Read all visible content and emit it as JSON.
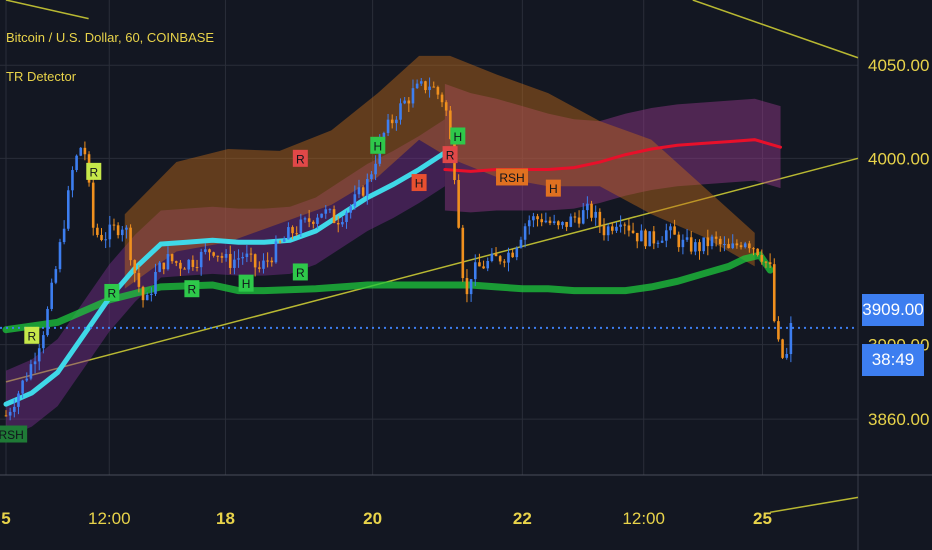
{
  "header": {
    "title": "Bitcoin / U.S. Dollar, 60, COINBASE",
    "indicator": "TR Detector"
  },
  "price_axis": {
    "current_price": "3909.00",
    "countdown": "38:49"
  },
  "colors": {
    "background": "#131722",
    "header_text": "#e8d34a",
    "axis_text": "#e8d34a",
    "price_tag": "#3d7ef0",
    "candle_up": "#3d7ef0",
    "candle_down": "#f0901e",
    "ma_cyan": "#3fd8e8",
    "ma_green": "#1ec83c",
    "ma_red": "#e8102a",
    "trendline": "#b8b832"
  },
  "chart_data": {
    "type": "line",
    "title": "Bitcoin / U.S. Dollar, 60, COINBASE",
    "ylim": [
      3830,
      4085
    ],
    "y_ticks": [
      {
        "label": "4050.00",
        "value": 4050
      },
      {
        "label": "4000.00",
        "value": 4000
      },
      {
        "label": "3900.00",
        "value": 3900
      },
      {
        "label": "3860.00",
        "value": 3860
      }
    ],
    "x_ticks": [
      {
        "label": "5",
        "t": 0
      },
      {
        "label": "12:00",
        "t": 2
      },
      {
        "label": "18",
        "t": 4.25
      },
      {
        "label": "20",
        "t": 7.1
      },
      {
        "label": "22",
        "t": 10.0
      },
      {
        "label": "12:00",
        "t": 12.35
      },
      {
        "label": "25",
        "t": 14.65
      }
    ],
    "x_range": [
      0,
      16.5
    ],
    "series": [
      {
        "key": "price",
        "x": [
          0,
          0.25,
          0.5,
          0.75,
          1.0,
          1.3,
          1.5,
          1.7,
          1.9,
          2.1,
          2.3,
          2.5,
          2.7,
          2.9,
          3.1,
          3.4,
          3.7,
          4.0,
          4.3,
          4.6,
          4.9,
          5.2,
          5.5,
          5.8,
          6.1,
          6.4,
          6.7,
          7.0,
          7.3,
          7.6,
          7.9,
          8.2,
          8.5,
          8.7,
          8.9,
          9.0,
          9.2,
          9.5,
          9.8,
          10.1,
          10.4,
          10.7,
          11.0,
          11.3,
          11.6,
          11.9,
          12.2,
          12.5,
          12.8,
          13.1,
          13.4,
          13.7,
          14.0,
          14.3,
          14.6,
          14.8,
          14.9,
          15.0,
          15.1,
          15.2
        ],
        "values": [
          3862,
          3875,
          3890,
          3910,
          3945,
          3995,
          4010,
          3960,
          3958,
          3962,
          3965,
          3938,
          3920,
          3938,
          3946,
          3943,
          3946,
          3952,
          3944,
          3948,
          3940,
          3950,
          3960,
          3965,
          3972,
          3967,
          3975,
          3987,
          4012,
          4026,
          4036,
          4040,
          4030,
          3990,
          3921,
          3938,
          3942,
          3946,
          3950,
          3967,
          3968,
          3962,
          3968,
          3972,
          3961,
          3969,
          3959,
          3956,
          3961,
          3954,
          3952,
          3956,
          3950,
          3957,
          3950,
          3940,
          3905,
          3895,
          3890,
          3909
        ]
      },
      {
        "key": "ma_cyan",
        "x": [
          0,
          0.5,
          1.0,
          1.5,
          2.0,
          2.5,
          3.0,
          3.5,
          4.0,
          4.5,
          5.0,
          5.5,
          6.0,
          6.5,
          7.0,
          7.5,
          8.0,
          8.5
        ],
        "values": [
          3868,
          3874,
          3885,
          3905,
          3925,
          3941,
          3954,
          3955,
          3956,
          3955,
          3955,
          3956,
          3961,
          3970,
          3979,
          3986,
          3994,
          4003
        ]
      },
      {
        "key": "ma_green",
        "x": [
          0,
          1,
          2,
          3,
          4,
          4.5,
          5,
          6,
          7,
          7.5,
          8,
          8.5,
          9,
          9.5,
          10,
          10.5,
          11,
          11.5,
          12,
          12.5,
          13,
          13.5,
          14,
          14.3,
          14.6,
          14.8
        ],
        "values": [
          3908,
          3912,
          3924,
          3931,
          3932,
          3929,
          3929,
          3930,
          3932,
          3932,
          3932,
          3932,
          3932,
          3931,
          3930,
          3930,
          3929,
          3929,
          3929,
          3931,
          3934,
          3938,
          3942,
          3946,
          3948,
          3940
        ]
      },
      {
        "key": "ma_red",
        "x": [
          8.5,
          9.0,
          9.5,
          10,
          10.5,
          11,
          11.5,
          12,
          12.5,
          13,
          13.5,
          14,
          14.5,
          15
        ],
        "values": [
          3994,
          3993,
          3994,
          3994,
          3994,
          3995,
          3998,
          4002,
          4005,
          4007,
          4008,
          4009,
          4010,
          4006
        ]
      }
    ],
    "trendlines": [
      {
        "x": [
          0,
          16.5
        ],
        "values": [
          3880,
          4000
        ]
      },
      {
        "x": [
          0,
          1.6
        ],
        "values": [
          4085,
          4075
        ]
      },
      {
        "x": [
          13.3,
          16.5
        ],
        "values": [
          4085,
          4054
        ]
      },
      {
        "x": [
          14.8,
          16.5
        ],
        "values": [
          3810,
          3818
        ]
      }
    ],
    "annotations": [
      {
        "label": "RSH",
        "x": 0.1,
        "value": 3852,
        "color": "#1f7a36"
      },
      {
        "label": "R",
        "x": 0.5,
        "value": 3905,
        "color": "#c6e84a"
      },
      {
        "label": "R",
        "x": 1.7,
        "value": 3993,
        "color": "#c6e84a"
      },
      {
        "label": "R",
        "x": 2.05,
        "value": 3928,
        "color": "#2ec84a"
      },
      {
        "label": "R",
        "x": 3.6,
        "value": 3930,
        "color": "#2ec84a"
      },
      {
        "label": "H",
        "x": 4.65,
        "value": 3933,
        "color": "#2ec84a"
      },
      {
        "label": "R",
        "x": 5.7,
        "value": 3939,
        "color": "#2ec84a"
      },
      {
        "label": "R",
        "x": 5.7,
        "value": 4000,
        "color": "#e04848"
      },
      {
        "label": "H",
        "x": 7.2,
        "value": 4007,
        "color": "#2ec84a"
      },
      {
        "label": "H",
        "x": 8.75,
        "value": 4012,
        "color": "#2ec84a"
      },
      {
        "label": "H",
        "x": 8.0,
        "value": 3987,
        "color": "#e85030"
      },
      {
        "label": "R",
        "x": 8.6,
        "value": 4002,
        "color": "#e04848"
      },
      {
        "label": "RSH",
        "x": 9.8,
        "value": 3990,
        "color": "#e07020"
      },
      {
        "label": "H",
        "x": 10.6,
        "value": 3984,
        "color": "#e07020"
      }
    ]
  }
}
